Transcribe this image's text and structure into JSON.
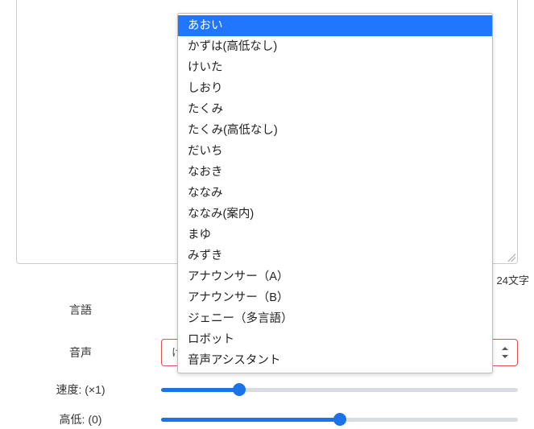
{
  "textarea": {
    "value": ""
  },
  "char_count_suffix": "24文字",
  "labels": {
    "language": "言語",
    "voice": "音声",
    "speed": "速度: (×1)",
    "pitch": "高低: (0)"
  },
  "voice_select": {
    "value": "けいた"
  },
  "dropdown": {
    "selected": "あおい",
    "options": [
      "あおい",
      "かずは(高低なし)",
      "けいた",
      "しおり",
      "たくみ",
      "たくみ(高低なし)",
      "だいち",
      "なおき",
      "ななみ",
      "ななみ(案内)",
      "まゆ",
      "みずき",
      "アナウンサー（A）",
      "アナウンサー（B）",
      "ジェニー（多言語）",
      "ロボット",
      "音声アシスタント"
    ]
  },
  "sliders": {
    "speed": {
      "percent": 22
    },
    "pitch": {
      "percent": 50
    }
  },
  "colors": {
    "accent": "#1a73e8",
    "select_border": "#d9534f",
    "highlight": "#2176ff"
  }
}
